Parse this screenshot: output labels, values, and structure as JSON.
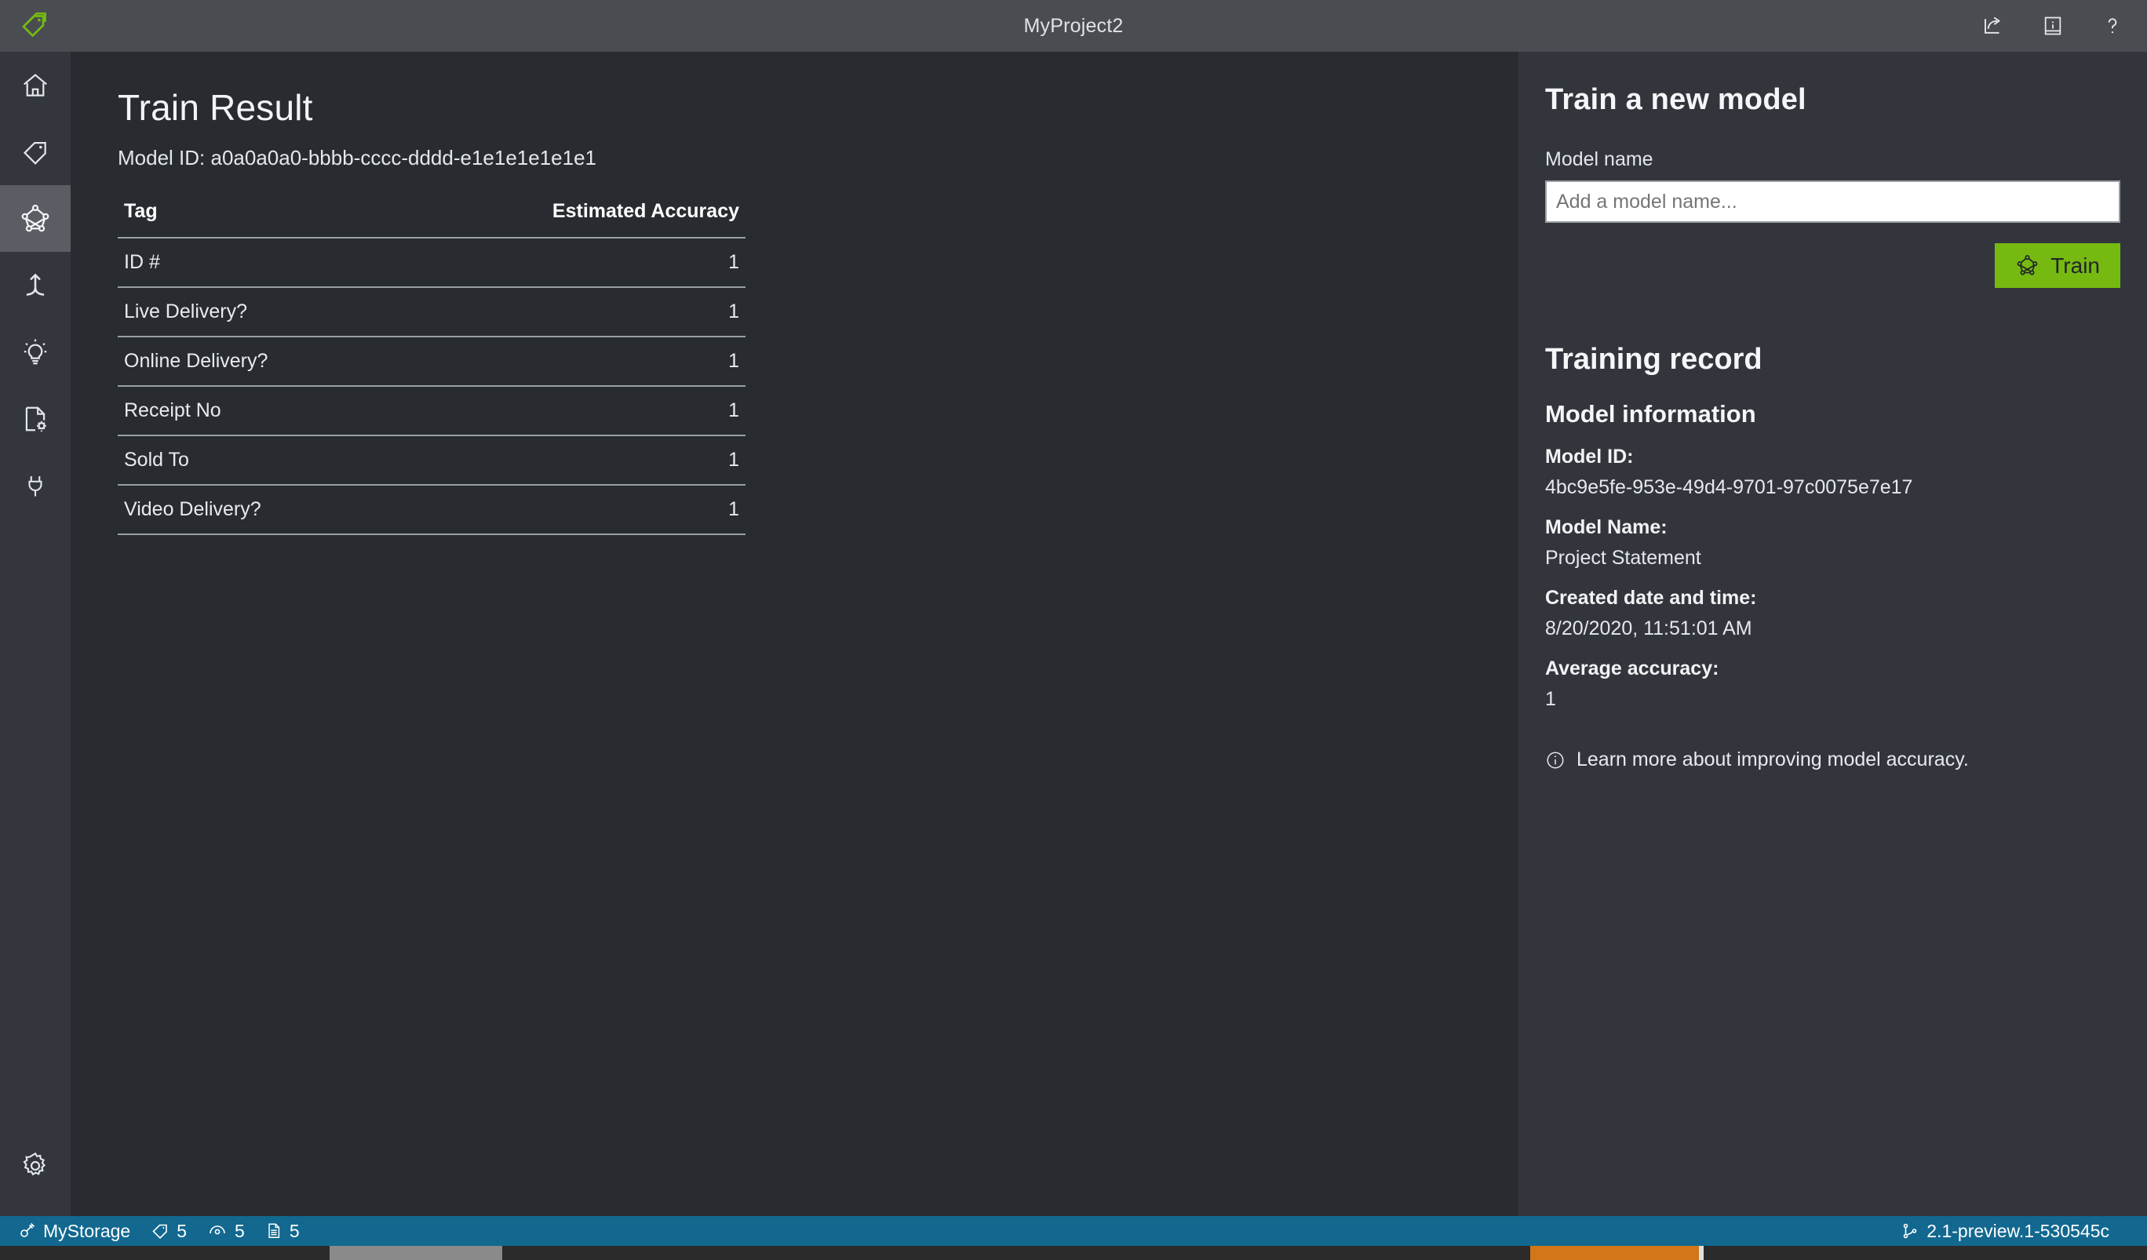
{
  "titlebar": {
    "logo_icon": "tags-logo-icon",
    "title": "MyProject2",
    "actions": [
      {
        "icon": "share-export-icon",
        "name": "share-button"
      },
      {
        "icon": "info-book-icon",
        "name": "documentation-button"
      },
      {
        "icon": "help-question-icon",
        "name": "help-button"
      }
    ]
  },
  "sidebar": {
    "items": [
      {
        "icon": "home-icon",
        "name": "sidebar-item-home",
        "selected": false
      },
      {
        "icon": "tag-icon",
        "name": "sidebar-item-tag-editor",
        "selected": false
      },
      {
        "icon": "model-network-icon",
        "name": "sidebar-item-train",
        "selected": true
      },
      {
        "icon": "merge-arrow-icon",
        "name": "sidebar-item-compose",
        "selected": false
      },
      {
        "icon": "lightbulb-icon",
        "name": "sidebar-item-predict",
        "selected": false
      },
      {
        "icon": "document-settings-icon",
        "name": "sidebar-item-model-compose",
        "selected": false
      },
      {
        "icon": "plug-icon",
        "name": "sidebar-item-connections",
        "selected": false
      }
    ],
    "bottom_item": {
      "icon": "gear-icon",
      "name": "sidebar-item-settings"
    }
  },
  "main": {
    "title": "Train Result",
    "model_id_label": "Model ID:",
    "model_id_value": "a0a0a0a0-bbbb-cccc-dddd-e1e1e1e1e1e1",
    "table": {
      "columns": [
        "Tag",
        "Estimated Accuracy"
      ],
      "rows": [
        {
          "tag": "ID #",
          "accuracy": "1"
        },
        {
          "tag": "Live Delivery?",
          "accuracy": "1"
        },
        {
          "tag": "Online Delivery?",
          "accuracy": "1"
        },
        {
          "tag": "Receipt No",
          "accuracy": "1"
        },
        {
          "tag": "Sold To",
          "accuracy": "1"
        },
        {
          "tag": "Video Delivery?",
          "accuracy": "1"
        }
      ]
    }
  },
  "right_panel": {
    "train_heading": "Train a new model",
    "model_name_label": "Model name",
    "model_name_value": "",
    "model_name_placeholder": "Add a model name...",
    "train_button_label": "Train",
    "train_button_icon": "model-network-icon",
    "train_button_color": "#76ba11",
    "training_record_heading": "Training record",
    "model_information_heading": "Model information",
    "fields": [
      {
        "key": "Model ID:",
        "value": "4bc9e5fe-953e-49d4-9701-97c0075e7e17"
      },
      {
        "key": "Model Name:",
        "value": "Project Statement"
      },
      {
        "key": "Created date and time:",
        "value": "8/20/2020, 11:51:01 AM"
      },
      {
        "key": "Average accuracy:",
        "value": "1"
      }
    ],
    "learn_more_icon": "info-circle-icon",
    "learn_more_text": "Learn more about improving model accuracy."
  },
  "statusbar": {
    "background": "#12688f",
    "storage_icon": "plug-icon",
    "storage_label": "MyStorage",
    "counts": [
      {
        "icon": "tag-icon",
        "value": "5",
        "name": "status-tag-count"
      },
      {
        "icon": "eye-icon",
        "value": "5",
        "name": "status-visited-count"
      },
      {
        "icon": "document-icon",
        "value": "5",
        "name": "status-document-count"
      }
    ],
    "version_icon": "branch-icon",
    "version": "2.1-preview.1-530545c"
  }
}
